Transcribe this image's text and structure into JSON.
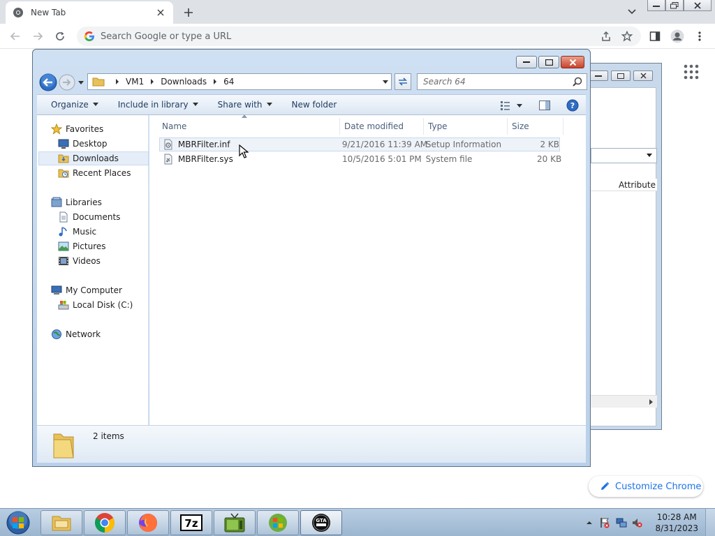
{
  "chrome": {
    "tab_title": "New Tab",
    "omnibox_placeholder": "Search Google or type a URL",
    "customize_label": "Customize Chrome"
  },
  "background_window": {
    "column_header": "Attribute"
  },
  "explorer": {
    "breadcrumb": [
      "VM1",
      "Downloads",
      "64"
    ],
    "search_placeholder": "Search 64",
    "commands": {
      "organize": "Organize",
      "include_in_library": "Include in library",
      "share_with": "Share with",
      "new_folder": "New folder"
    },
    "nav": {
      "favorites": "Favorites",
      "desktop": "Desktop",
      "downloads": "Downloads",
      "recent_places": "Recent Places",
      "libraries": "Libraries",
      "documents": "Documents",
      "music": "Music",
      "pictures": "Pictures",
      "videos": "Videos",
      "my_computer": "My Computer",
      "local_disk": "Local Disk (C:)",
      "network": "Network"
    },
    "columns": {
      "name": "Name",
      "date_modified": "Date modified",
      "type": "Type",
      "size": "Size"
    },
    "files": [
      {
        "name": "MBRFilter.inf",
        "date": "9/21/2016 11:39 AM",
        "type": "Setup Information",
        "size": "2 KB"
      },
      {
        "name": "MBRFilter.sys",
        "date": "10/5/2016 5:01 PM",
        "type": "System file",
        "size": "20 KB"
      }
    ],
    "status_count": "2 items"
  },
  "taskbar": {
    "apps": [
      "windows-explorer",
      "google-chrome",
      "firefox",
      "7-zip",
      "media-app",
      "windows-app",
      "gta-app"
    ],
    "clock_time": "10:28 AM",
    "clock_date": "8/31/2023"
  },
  "colors": {
    "explorer_frame": "#b9d0ea",
    "chrome_tabbar": "#dee1e6",
    "accent_blue": "#1a73e8",
    "close_red": "#c8432a"
  }
}
